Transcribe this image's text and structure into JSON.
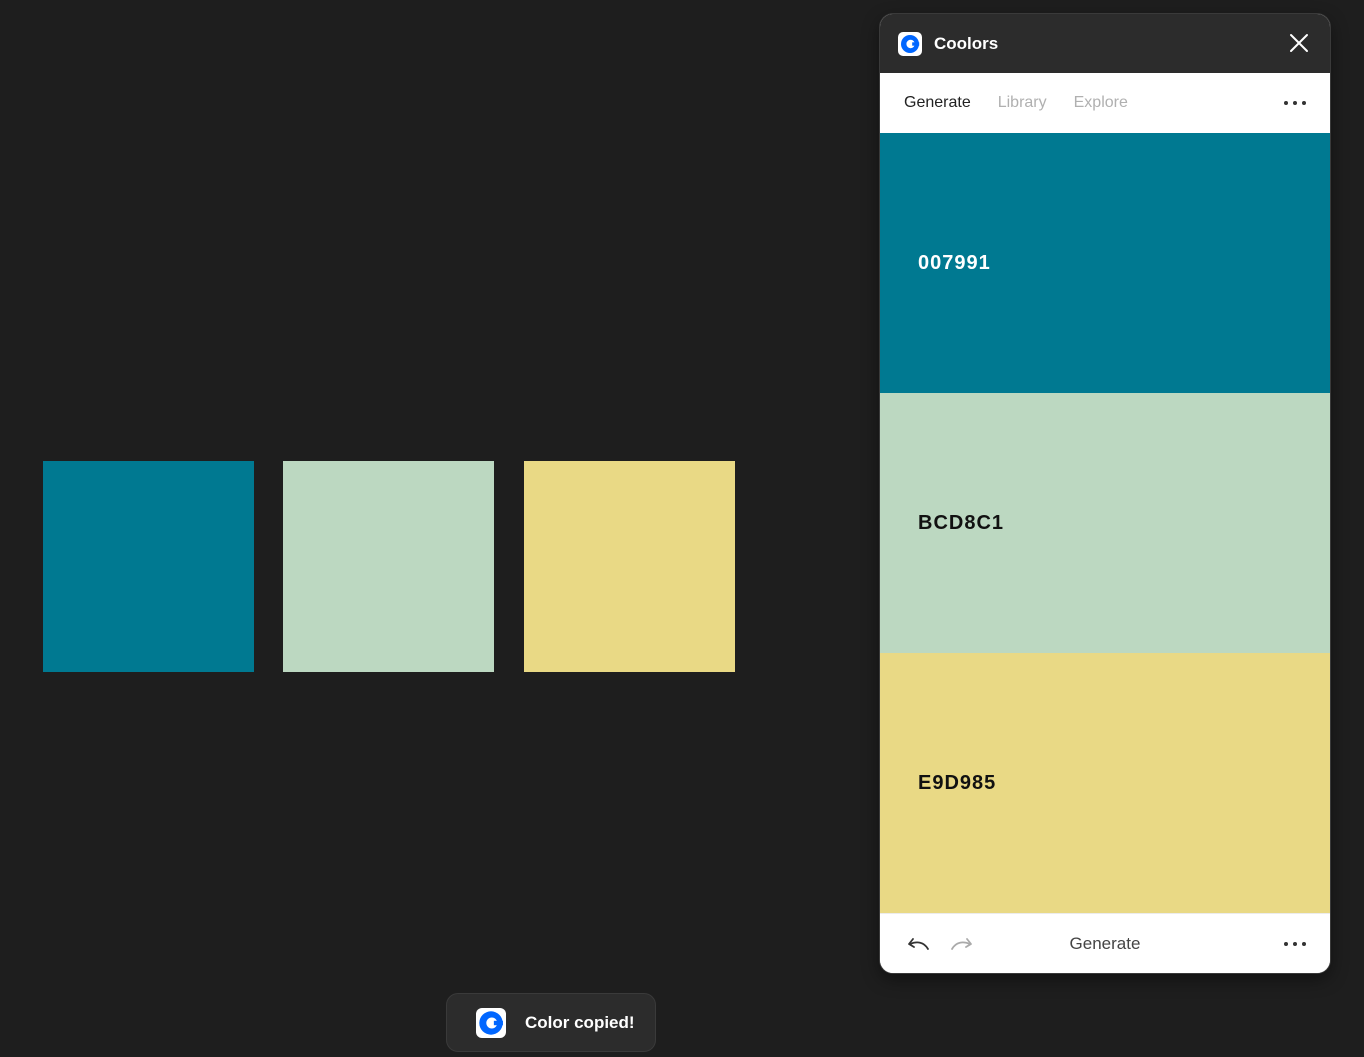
{
  "canvas": {
    "swatches": [
      {
        "hex": "#007991"
      },
      {
        "hex": "#BCD8C1"
      },
      {
        "hex": "#E9D985"
      }
    ]
  },
  "panel": {
    "title": "Coolors",
    "logo_icon": "coolors-logo-icon",
    "close_icon": "close-icon",
    "tabs": [
      {
        "label": "Generate",
        "active": true
      },
      {
        "label": "Library",
        "active": false
      },
      {
        "label": "Explore",
        "active": false
      }
    ],
    "tabs_more_icon": "more-horizontal-icon",
    "colors": [
      {
        "code": "007991",
        "hex": "#007991",
        "text_color": "#ffffff"
      },
      {
        "code": "BCD8C1",
        "hex": "#BCD8C1",
        "text_color": "#111111"
      },
      {
        "code": "E9D985",
        "hex": "#E9D985",
        "text_color": "#111111"
      }
    ],
    "footer": {
      "undo_icon": "undo-icon",
      "redo_icon": "redo-icon",
      "generate_label": "Generate",
      "more_icon": "more-horizontal-icon"
    }
  },
  "toast": {
    "text": "Color copied!",
    "icon": "coolors-logo-icon"
  },
  "colors": {
    "background": "#1e1e1e",
    "panel_header": "#2c2c2c",
    "brand_blue": "#0066ff"
  }
}
